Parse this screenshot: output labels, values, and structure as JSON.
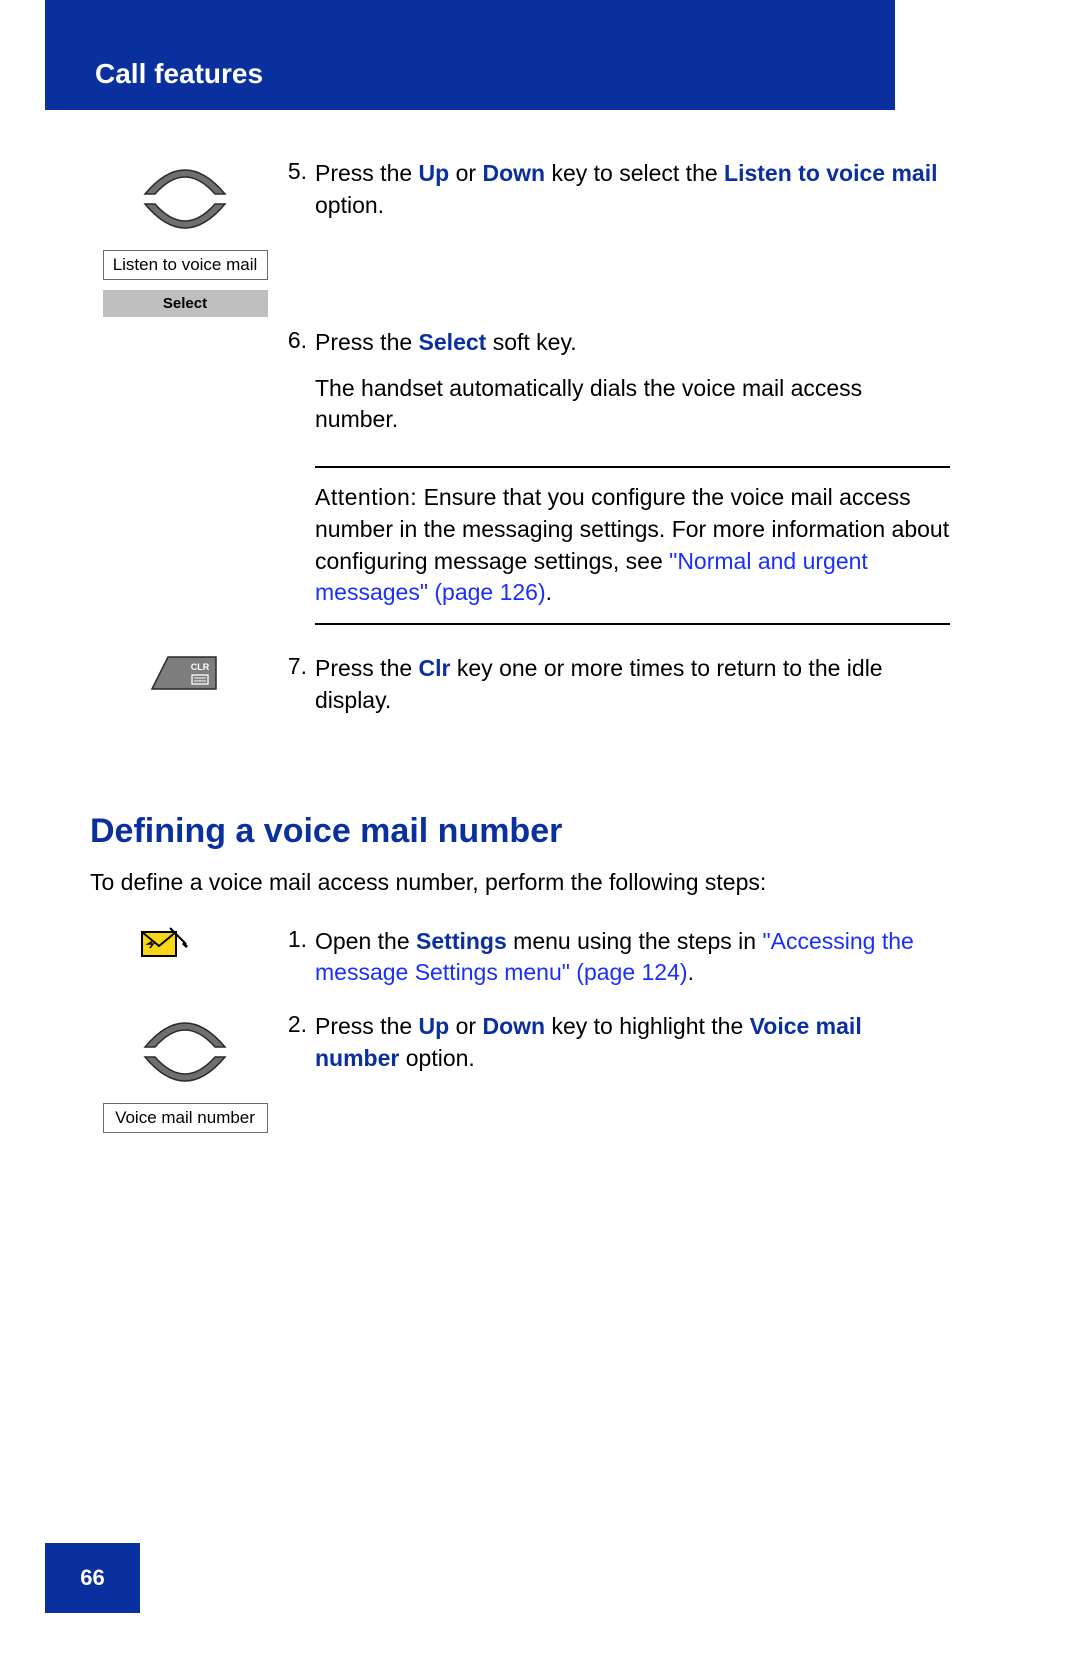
{
  "header": {
    "title": "Call features"
  },
  "icons": {
    "listen_label": "Listen to voice mail",
    "select_label": "Select",
    "voice_label": "Voice mail number"
  },
  "steps_a": {
    "s5": {
      "num": "5.",
      "pre": "Press the ",
      "up": "Up",
      "mid1": " or ",
      "down": "Down",
      "mid2": " key to select the ",
      "listen": "Listen to voice mail",
      "post": " option."
    },
    "s6": {
      "num": "6.",
      "pre": "Press the ",
      "select": "Select",
      "post": " soft key.",
      "para2": "The handset automatically dials the voice mail access number."
    },
    "s7": {
      "num": "7.",
      "pre": "Press the ",
      "clr": "Clr",
      "post": " key one or more times to return to the idle display."
    }
  },
  "attention": {
    "lead": "Attention:",
    "body1": " Ensure that you configure the voice mail access number in the messaging settings. For more information about configuring message settings, see ",
    "link": "\"Normal and urgent messages\" (page 126)",
    "body2": "."
  },
  "section": {
    "heading": "Defining a voice mail number",
    "intro": "To define a voice mail access number, perform the following steps:"
  },
  "steps_b": {
    "s1": {
      "num": "1.",
      "pre": "Open the ",
      "settings": "Settings",
      "mid": " menu using the steps in ",
      "link": "\"Accessing the message Settings menu\" (page 124)",
      "post": "."
    },
    "s2": {
      "num": "2.",
      "pre": "Press the ",
      "up": "Up",
      "mid1": " or ",
      "down": "Down",
      "mid2": " key to highlight the ",
      "voice": "Voice mail number",
      "post": " option."
    }
  },
  "footer": {
    "page": "66"
  }
}
